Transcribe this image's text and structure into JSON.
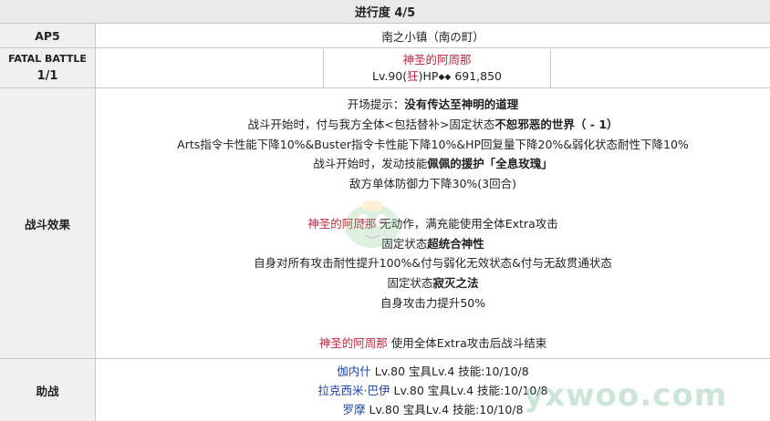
{
  "header": {
    "progress": "进行度 4/5"
  },
  "ap_row": {
    "label": "AP5",
    "location": "南之小镇（南の町）"
  },
  "fatal_row": {
    "label_line1": "FATAL BATTLE",
    "label_line2": "1/1",
    "enemy_name": "神圣的阿周那",
    "level_prefix": "Lv.90(",
    "class_icon": "狂",
    "level_suffix": ")HP",
    "hp_icons": "◆◆",
    "hp_value": "691,850"
  },
  "effects": {
    "label": "战斗效果",
    "lines": {
      "l1_prefix": "开场提示：",
      "l1_bold": "没有传达至神明的道理",
      "l2_prefix": "战斗开始时，付与我方全体<包括替补>固定状态",
      "l2_bold": "不恕邪恶的世界（ - 1）",
      "l3": "Arts指令卡性能下降10%&Buster指令卡性能下降10%&HP回复量下降20%&弱化状态耐性下降10%",
      "l4_prefix": "战斗开始时，发动技能",
      "l4_bold": "佩佩的援护「全息玫瑰」",
      "l5": "敌方单体防御力下降30%(3回合)",
      "l7_name": "神圣的阿周那",
      "l7_text": " 无动作，满充能使用全体Extra攻击",
      "l8_prefix": "固定状态",
      "l8_bold": "超统合神性",
      "l9": "自身对所有攻击耐性提升100%&付与弱化无效状态&付与无敌贯通状态",
      "l10_prefix": "固定状态",
      "l10_bold": "寂灭之法",
      "l11": "自身攻击力提升50%",
      "l13_name": "神圣的阿周那",
      "l13_text": " 使用全体Extra攻击后战斗结束"
    }
  },
  "support": {
    "label": "助战",
    "rows": [
      {
        "name": "伽内什",
        "details": " Lv.80 宝具Lv.4 技能:10/10/8"
      },
      {
        "name": "拉克西米·巴伊",
        "details": " Lv.80 宝具Lv.4 技能:10/10/8"
      },
      {
        "name": "罗摩",
        "details": " Lv.80 宝具Lv.4 技能:10/10/8"
      }
    ]
  },
  "watermark": "yxwoo.com",
  "colors": {
    "enemy_name": "#c8253f",
    "servant_name": "#1a44a8",
    "header_bg": "#e9e9e9",
    "label_bg": "#f0f0f0"
  }
}
